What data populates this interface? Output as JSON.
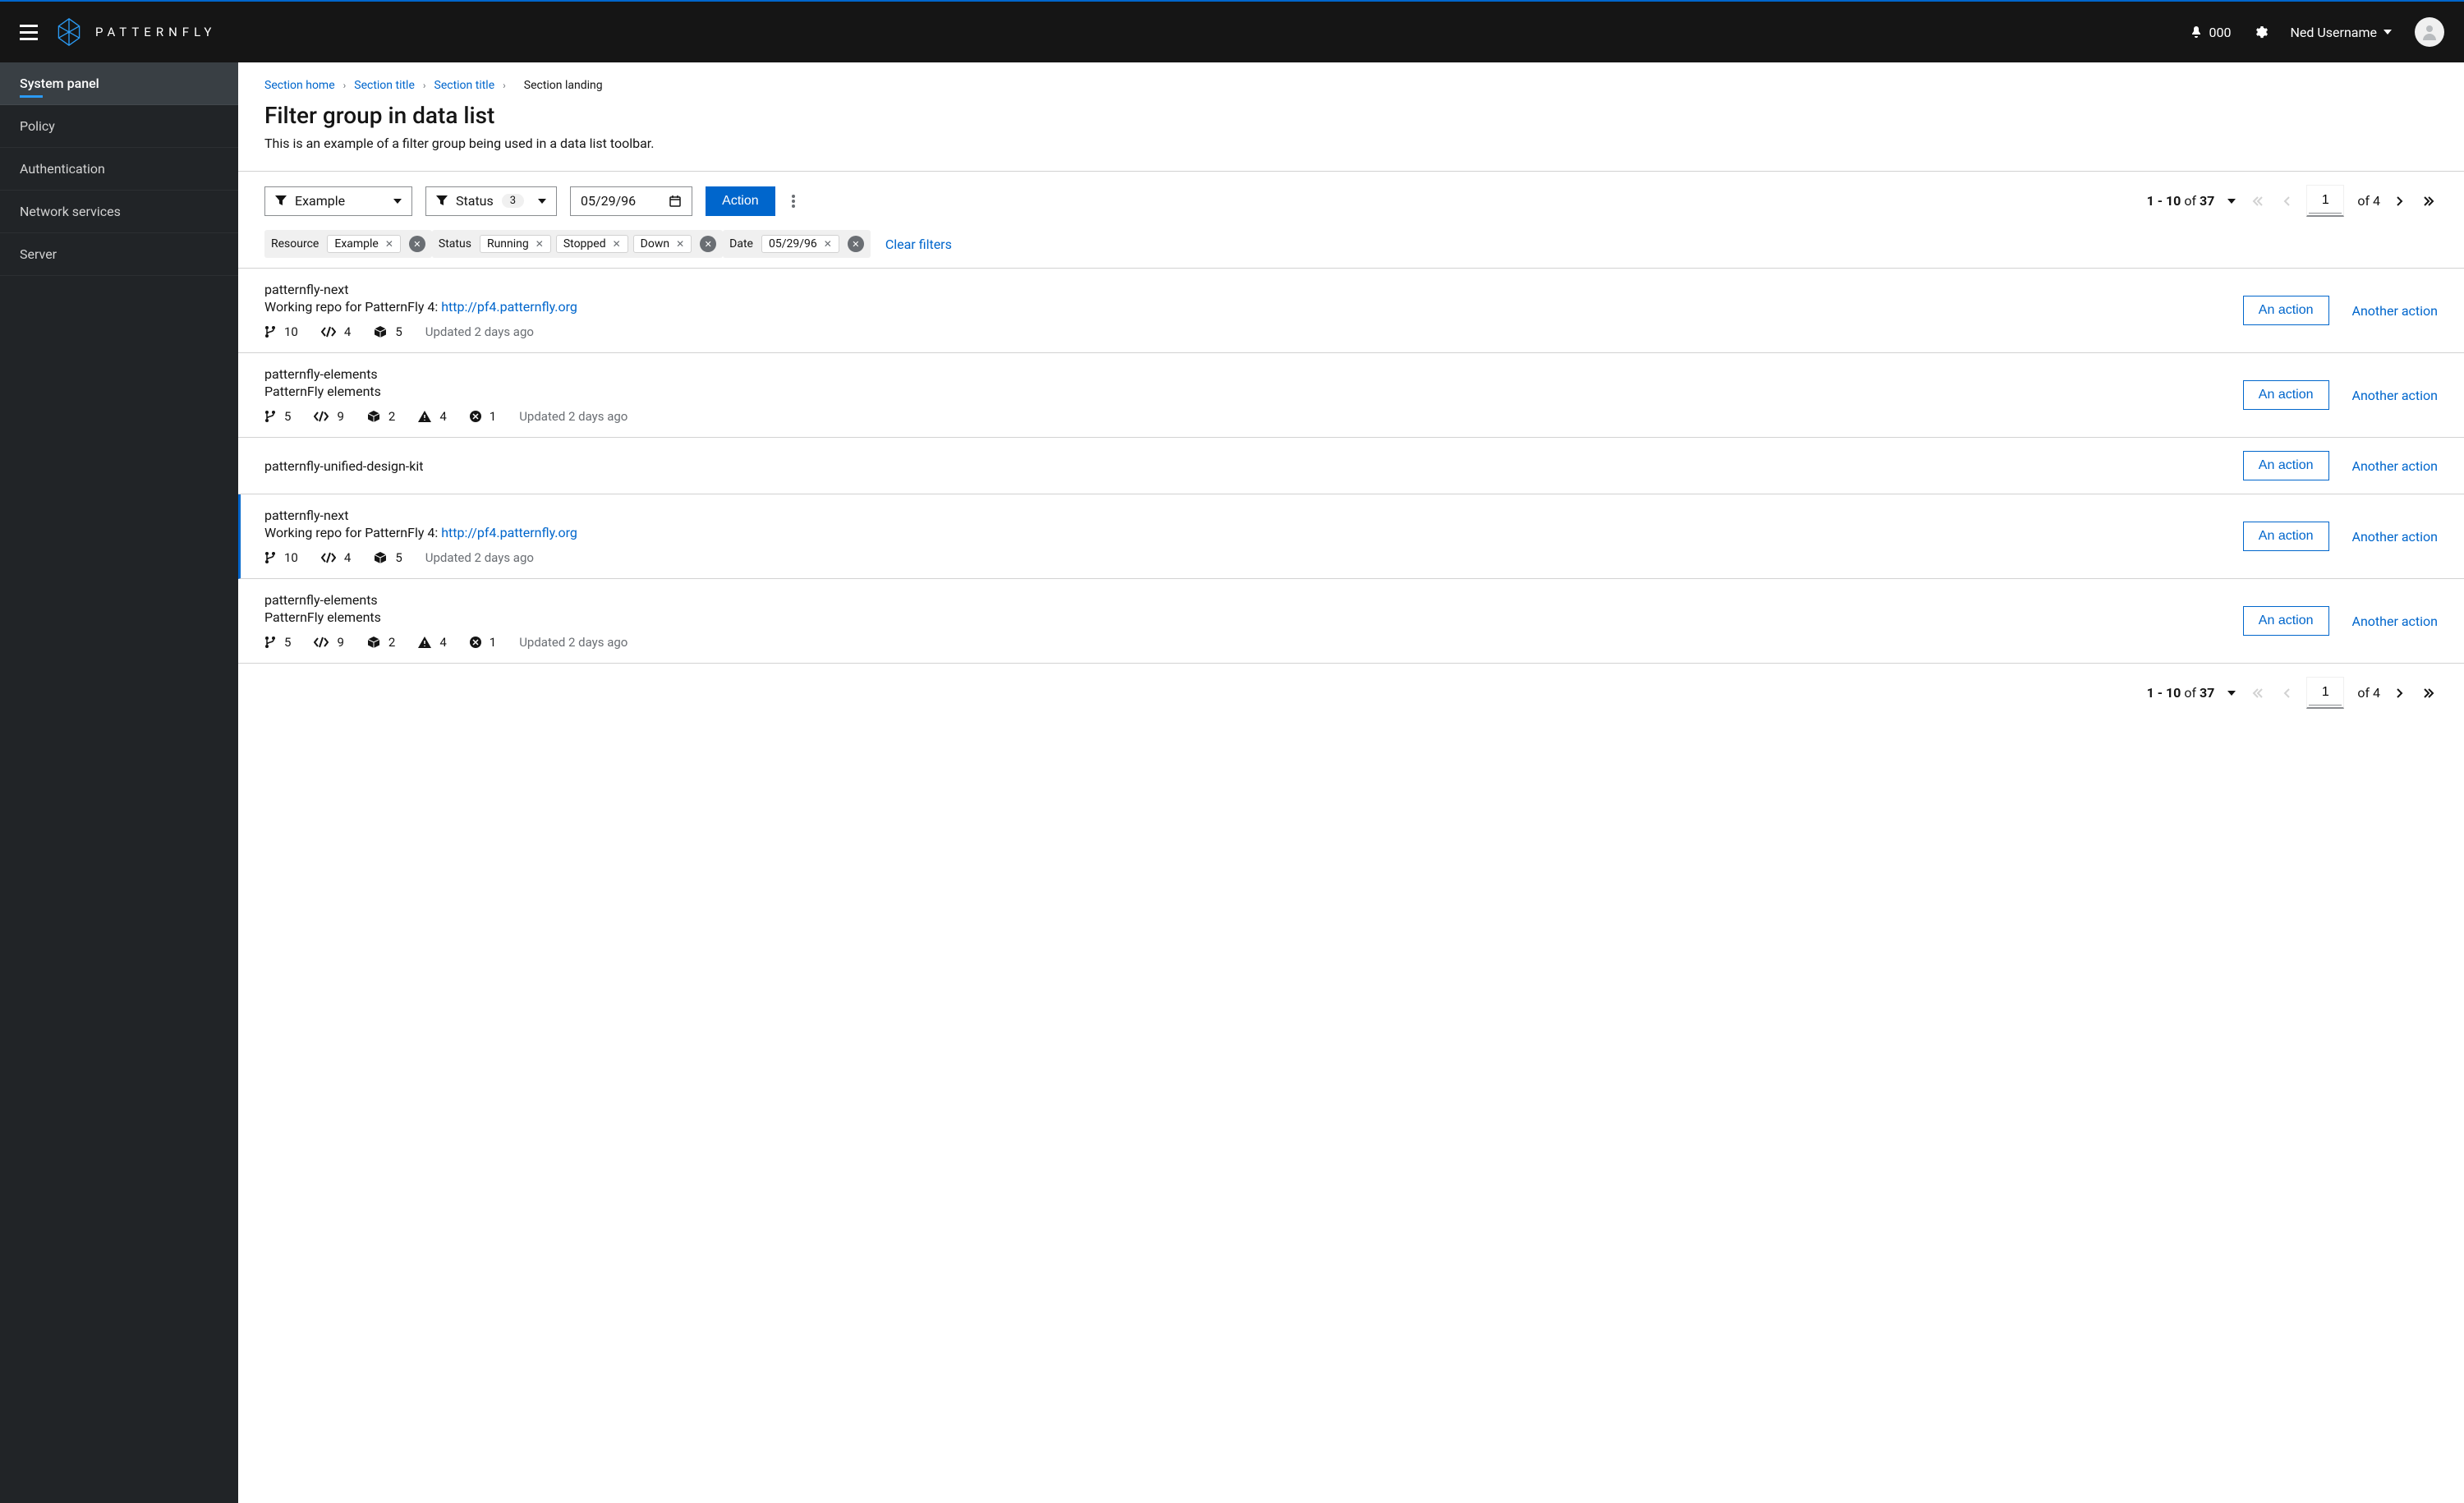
{
  "header": {
    "brand": "PATTERNFLY",
    "notification_count": "000",
    "username": "Ned Username"
  },
  "sidebar": {
    "items": [
      {
        "label": "System panel",
        "active": true
      },
      {
        "label": "Policy",
        "active": false
      },
      {
        "label": "Authentication",
        "active": false
      },
      {
        "label": "Network services",
        "active": false
      },
      {
        "label": "Server",
        "active": false
      }
    ]
  },
  "breadcrumb": {
    "items": [
      "Section home",
      "Section title",
      "Section title"
    ],
    "current": "Section landing"
  },
  "page": {
    "title": "Filter group in data list",
    "description": "This is an example of a filter group being used in a data list toolbar."
  },
  "toolbar": {
    "filter1_label": "Example",
    "filter2_label": "Status",
    "filter2_count": "3",
    "date_value": "05/29/96",
    "action_label": "Action"
  },
  "chips": {
    "groups": [
      {
        "label": "Resource",
        "chips": [
          "Example"
        ]
      },
      {
        "label": "Status",
        "chips": [
          "Running",
          "Stopped",
          "Down"
        ]
      },
      {
        "label": "Date",
        "chips": [
          "05/29/96"
        ]
      }
    ],
    "clear_label": "Clear filters"
  },
  "pagination": {
    "range": "1 - 10",
    "of_label": "of",
    "total": "37",
    "page": "1",
    "pages": "4"
  },
  "list": [
    {
      "title": "patternfly-next",
      "desc": "Working repo for PatternFly 4: ",
      "link": "http://pf4.patternfly.org",
      "stats": {
        "fork": "10",
        "code": "4",
        "cube": "5"
      },
      "warnings": null,
      "updated": "Updated 2 days ago",
      "selected": false
    },
    {
      "title": "patternfly-elements",
      "desc": "PatternFly elements",
      "link": null,
      "stats": {
        "fork": "5",
        "code": "9",
        "cube": "2"
      },
      "warnings": {
        "warn": "4",
        "error": "1"
      },
      "updated": "Updated 2 days ago",
      "selected": false
    },
    {
      "title": "patternfly-unified-design-kit",
      "desc": null,
      "link": null,
      "stats": null,
      "warnings": null,
      "updated": null,
      "selected": false
    },
    {
      "title": "patternfly-next",
      "desc": "Working repo for PatternFly 4: ",
      "link": "http://pf4.patternfly.org",
      "stats": {
        "fork": "10",
        "code": "4",
        "cube": "5"
      },
      "warnings": null,
      "updated": "Updated 2 days ago",
      "selected": true
    },
    {
      "title": "patternfly-elements",
      "desc": "PatternFly elements",
      "link": null,
      "stats": {
        "fork": "5",
        "code": "9",
        "cube": "2"
      },
      "warnings": {
        "warn": "4",
        "error": "1"
      },
      "updated": "Updated 2 days ago",
      "selected": false
    }
  ],
  "actions": {
    "primary": "An action",
    "secondary": "Another action"
  }
}
